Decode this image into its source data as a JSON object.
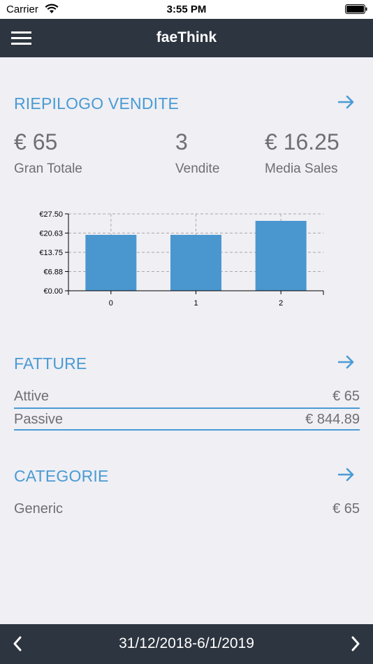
{
  "status_bar": {
    "carrier": "Carrier",
    "time": "3:55 PM"
  },
  "header": {
    "title": "faeThink"
  },
  "sales_summary": {
    "title": "RIEPILOGO VENDITE",
    "stats": [
      {
        "value": "€ 65",
        "label": "Gran Totale"
      },
      {
        "value": "3",
        "label": "Vendite"
      },
      {
        "value": "€ 16.25",
        "label": "Media Sales"
      }
    ]
  },
  "chart_data": {
    "type": "bar",
    "categories": [
      "0",
      "1",
      "2"
    ],
    "values": [
      20,
      20,
      25
    ],
    "ylim": [
      0,
      27.5
    ],
    "yticks": [
      "€0.00",
      "€6.88",
      "€13.75",
      "€20.63",
      "€27.50"
    ],
    "ytick_values": [
      0,
      6.88,
      13.75,
      20.63,
      27.5
    ],
    "bar_color": "#4a97cf",
    "grid": true
  },
  "invoices": {
    "title": "FATTURE",
    "rows": [
      {
        "label": "Attive",
        "value": "€ 65"
      },
      {
        "label": "Passive",
        "value": "€ 844.89"
      }
    ]
  },
  "categories": {
    "title": "CATEGORIE",
    "rows": [
      {
        "label": "Generic",
        "value": "€ 65"
      }
    ]
  },
  "footer": {
    "date_range": "31/12/2018-6/1/2019"
  },
  "colors": {
    "accent": "#4a9bd3",
    "navbar": "#2d3540",
    "background": "#efeff4"
  }
}
